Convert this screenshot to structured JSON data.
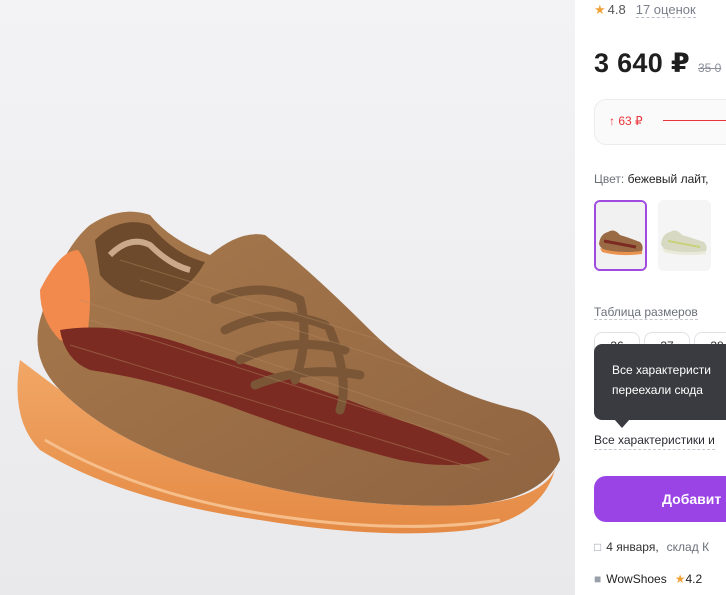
{
  "product": {
    "image_alt_icon": "sneaker-photo"
  },
  "rating": {
    "score": "4.8",
    "reviews": "17 оценок"
  },
  "price": {
    "current": "3 640 ₽",
    "old": "35 0"
  },
  "price_history": {
    "delta": "↑ 63 ₽"
  },
  "color": {
    "label": "Цвет:",
    "value": "бежевый лайт,"
  },
  "sizes": {
    "label": "Таблица размеров",
    "items": [
      "36",
      "37",
      "38"
    ]
  },
  "tooltip": {
    "line1": "Все характеристи",
    "line2": "переехали сюда"
  },
  "specs": {
    "faint": "",
    "all_link": "Все характеристики и"
  },
  "cart": {
    "add_label": "Добавит"
  },
  "delivery": {
    "date": "4 января,",
    "warehouse": "склад К"
  },
  "seller": {
    "name": "WowShoes",
    "rating": "4.2"
  },
  "colors": {
    "accent": "#9a44e6",
    "price_drop": "#e8343b",
    "star": "#f1a33a"
  }
}
